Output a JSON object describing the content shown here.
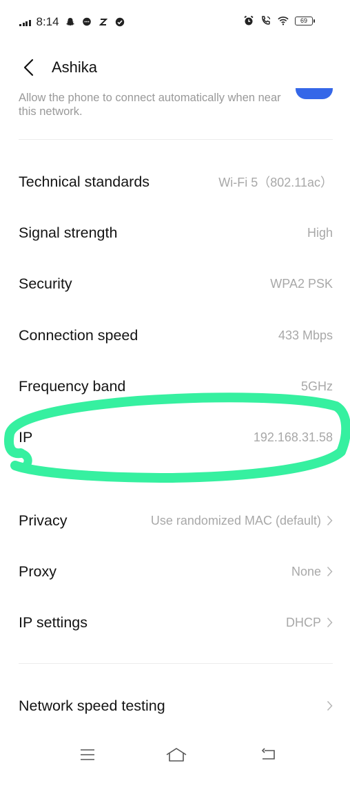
{
  "status_bar": {
    "time": "8:14",
    "left_icons": [
      "signal-icon",
      "snapchat-icon",
      "chat-icon",
      "z-icon",
      "check-icon"
    ],
    "right_icons": [
      "alarm-icon",
      "call-icon",
      "wifi-icon",
      "battery-icon"
    ],
    "battery": "69"
  },
  "header": {
    "back_icon": "chevron-left-icon",
    "title": "Ashika"
  },
  "auto_connect": {
    "text": "Allow the phone to connect automatically when near this network.",
    "toggle_on": true,
    "toggle_color": "#3567e8"
  },
  "details": [
    {
      "label": "Technical standards",
      "value": "Wi-Fi 5（802.11ac）"
    },
    {
      "label": "Signal strength",
      "value": "High"
    },
    {
      "label": "Security",
      "value": "WPA2 PSK"
    },
    {
      "label": "Connection speed",
      "value": "433 Mbps"
    },
    {
      "label": "Frequency band",
      "value": "5GHz"
    },
    {
      "label": "IP",
      "value": "192.168.31.58"
    }
  ],
  "settings": [
    {
      "label": "Privacy",
      "value": "Use randomized MAC (default)"
    },
    {
      "label": "Proxy",
      "value": "None"
    },
    {
      "label": "IP settings",
      "value": "DHCP"
    }
  ],
  "speed_test": {
    "label": "Network speed testing"
  },
  "annotation": {
    "color": "#36f0a0",
    "target": "IP"
  },
  "nav_bar": {
    "icons": [
      "menu-icon",
      "home-icon",
      "back-icon"
    ]
  }
}
